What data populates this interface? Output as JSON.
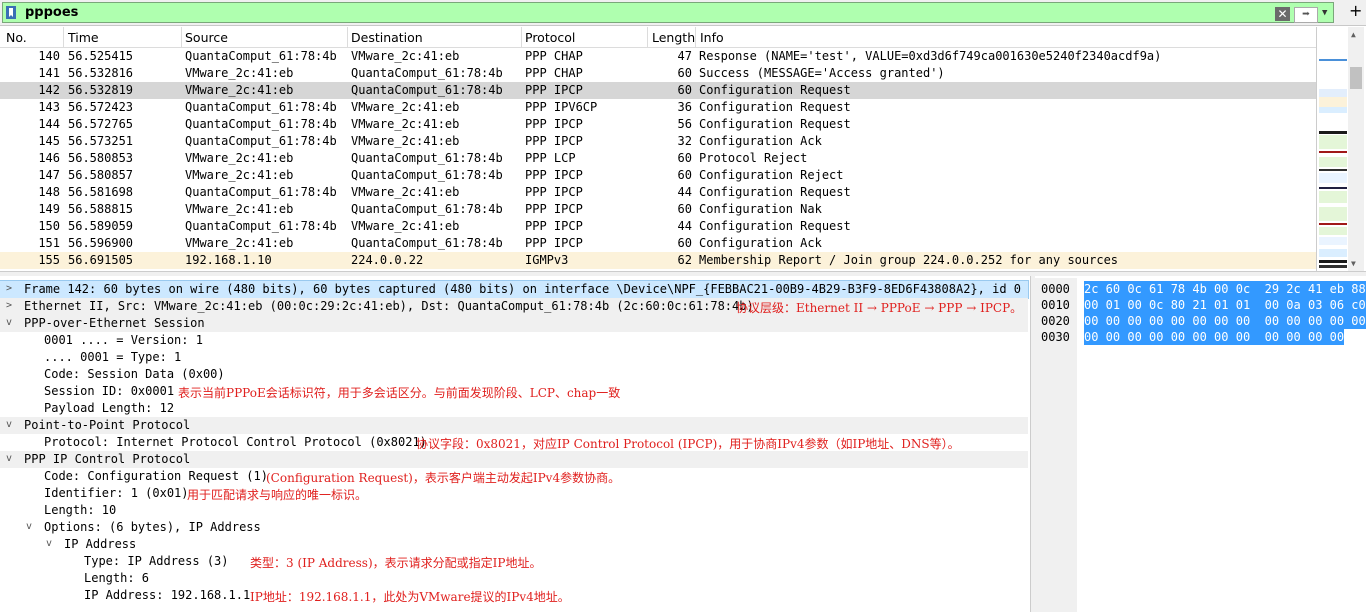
{
  "filter": {
    "value": "pppoes"
  },
  "columns": [
    "No.",
    "Time",
    "Source",
    "Destination",
    "Protocol",
    "Length",
    "Info"
  ],
  "packets": [
    {
      "no": "140",
      "time": "56.525415",
      "src": "QuantaComput_61:78:4b",
      "dst": "VMware_2c:41:eb",
      "proto": "PPP CHAP",
      "len": "47",
      "info": "Response (NAME='test', VALUE=0xd3d6f749ca001630e5240f2340acdf9a)"
    },
    {
      "no": "141",
      "time": "56.532816",
      "src": "VMware_2c:41:eb",
      "dst": "QuantaComput_61:78:4b",
      "proto": "PPP CHAP",
      "len": "60",
      "info": "Success (MESSAGE='Access granted')"
    },
    {
      "no": "142",
      "time": "56.532819",
      "src": "VMware_2c:41:eb",
      "dst": "QuantaComput_61:78:4b",
      "proto": "PPP IPCP",
      "len": "60",
      "info": "Configuration Request"
    },
    {
      "no": "143",
      "time": "56.572423",
      "src": "QuantaComput_61:78:4b",
      "dst": "VMware_2c:41:eb",
      "proto": "PPP IPV6CP",
      "len": "36",
      "info": "Configuration Request"
    },
    {
      "no": "144",
      "time": "56.572765",
      "src": "QuantaComput_61:78:4b",
      "dst": "VMware_2c:41:eb",
      "proto": "PPP IPCP",
      "len": "56",
      "info": "Configuration Request"
    },
    {
      "no": "145",
      "time": "56.573251",
      "src": "QuantaComput_61:78:4b",
      "dst": "VMware_2c:41:eb",
      "proto": "PPP IPCP",
      "len": "32",
      "info": "Configuration Ack"
    },
    {
      "no": "146",
      "time": "56.580853",
      "src": "VMware_2c:41:eb",
      "dst": "QuantaComput_61:78:4b",
      "proto": "PPP LCP",
      "len": "60",
      "info": "Protocol Reject"
    },
    {
      "no": "147",
      "time": "56.580857",
      "src": "VMware_2c:41:eb",
      "dst": "QuantaComput_61:78:4b",
      "proto": "PPP IPCP",
      "len": "60",
      "info": "Configuration Reject"
    },
    {
      "no": "148",
      "time": "56.581698",
      "src": "QuantaComput_61:78:4b",
      "dst": "VMware_2c:41:eb",
      "proto": "PPP IPCP",
      "len": "44",
      "info": "Configuration Request"
    },
    {
      "no": "149",
      "time": "56.588815",
      "src": "VMware_2c:41:eb",
      "dst": "QuantaComput_61:78:4b",
      "proto": "PPP IPCP",
      "len": "60",
      "info": "Configuration Nak"
    },
    {
      "no": "150",
      "time": "56.589059",
      "src": "QuantaComput_61:78:4b",
      "dst": "VMware_2c:41:eb",
      "proto": "PPP IPCP",
      "len": "44",
      "info": "Configuration Request"
    },
    {
      "no": "151",
      "time": "56.596900",
      "src": "VMware_2c:41:eb",
      "dst": "QuantaComput_61:78:4b",
      "proto": "PPP IPCP",
      "len": "60",
      "info": "Configuration Ack"
    },
    {
      "no": "155",
      "time": "56.691505",
      "src": "192.168.1.10",
      "dst": "224.0.0.22",
      "proto": "IGMPv3",
      "len": "62",
      "info": "Membership Report / Join group 224.0.0.252 for any sources"
    }
  ],
  "details": {
    "frame": "Frame 142: 60 bytes on wire (480 bits), 60 bytes captured (480 bits) on interface \\Device\\NPF_{FEBBAC21-00B9-4B29-B3F9-8ED6F43808A2}, id 0",
    "ethernet": "Ethernet II, Src: VMware_2c:41:eb (00:0c:29:2c:41:eb), Dst: QuantaComput_61:78:4b (2c:60:0c:61:78:4b)",
    "ethernet_note": "协议层级：Ethernet II → PPPoE → PPP → IPCP。",
    "pppoes": "PPP-over-Ethernet Session",
    "version": "0001 .... = Version: 1",
    "type": ".... 0001 = Type: 1",
    "code": "Code: Session Data (0x00)",
    "session_id": "Session ID: 0x0001",
    "session_note": "表示当前PPPoE会话标识符，用于多会话区分。与前面发现阶段、LCP、chap一致",
    "payload_len": "Payload Length: 12",
    "ppp": "Point-to-Point Protocol",
    "protocol": "Protocol: Internet Protocol Control Protocol (0x8021)",
    "protocol_note": "协议字段：0x8021，对应IP Control Protocol (IPCP)，用于协商IPv4参数（如IP地址、DNS等）。",
    "ipcp": "PPP IP Control Protocol",
    "ipcp_code": "Code: Configuration Request (1)",
    "ipcp_code_note": "(Configuration Request)，表示客户端主动发起IPv4参数协商。",
    "identifier": "Identifier: 1 (0x01)",
    "identifier_note": "用于匹配请求与响应的唯一标识。",
    "length": "Length: 10",
    "options": "Options: (6 bytes), IP Address",
    "ip_address": "IP Address",
    "opt_type": "Type: IP Address (3)",
    "opt_type_note": "类型：3 (IP Address)，表示请求分配或指定IP地址。",
    "opt_len": "Length: 6",
    "opt_ip": "IP Address: 192.168.1.1",
    "opt_ip_note": "IP地址：192.168.1.1，此处为VMware提议的IPv4地址。"
  },
  "bytes": {
    "offsets": [
      "0000",
      "0010",
      "0020",
      "0030"
    ],
    "hex": [
      "2c 60 0c 61 78 4b 00 0c  29 2c 41 eb 88",
      "00 01 00 0c 80 21 01 01  00 0a 03 06 c0",
      "00 00 00 00 00 00 00 00  00 00 00 00 00",
      "00 00 00 00 00 00 00 00  00 00 00 00"
    ]
  },
  "colors": {
    "filter_valid": "#afffaf",
    "selected_row": "#d6d6d6",
    "igmp_row": "#fcf2da",
    "annotation": "#e0201e",
    "bytes_highlight": "#3399ff"
  }
}
